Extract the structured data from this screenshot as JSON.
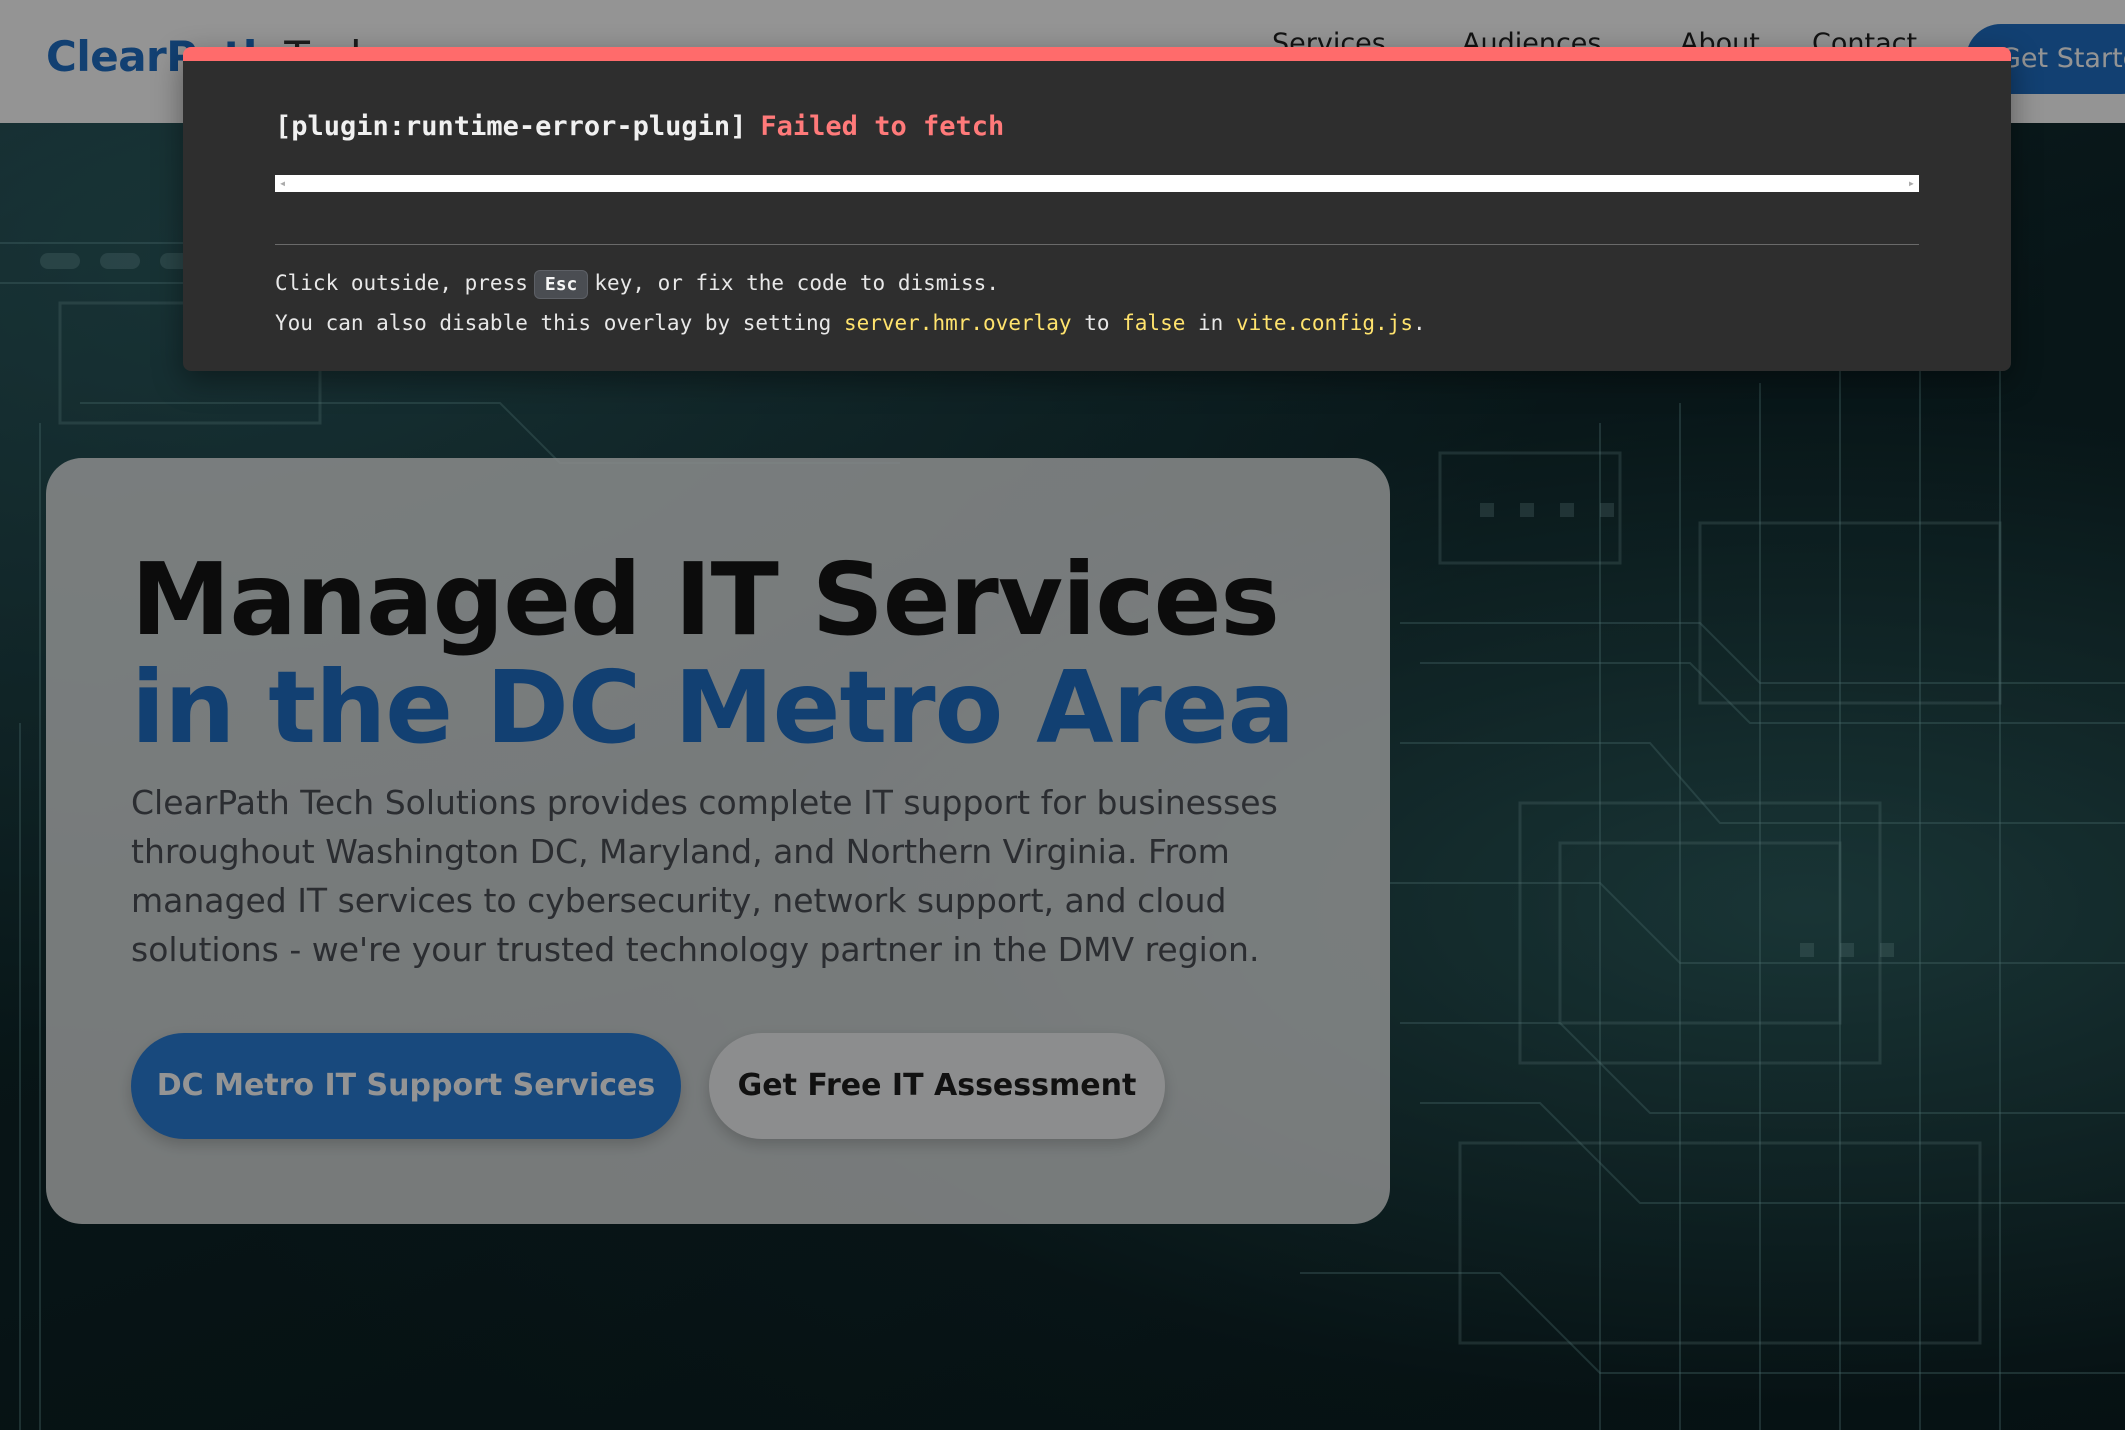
{
  "header": {
    "logo_main": "ClearPath",
    "logo_sub": "Tech",
    "nav": [
      {
        "label": "Services",
        "has_dropdown": true
      },
      {
        "label": "Audiences",
        "has_dropdown": true
      },
      {
        "label": "About",
        "has_dropdown": false
      },
      {
        "label": "Contact",
        "has_dropdown": false
      }
    ],
    "cta_label": "Get Started"
  },
  "hero": {
    "title_main": "Managed IT Services",
    "title_accent": "in the DC Metro Area",
    "description": "ClearPath Tech Solutions provides complete IT support for businesses throughout Washington DC, Maryland, and Northern Virginia. From managed IT services to cybersecurity, network support, and cloud solutions - we're your trusted technology partner in the DMV region.",
    "primary_button": "DC Metro IT Support Services",
    "secondary_button": "Get Free IT Assessment"
  },
  "error_overlay": {
    "plugin": "[plugin:runtime-error-plugin]",
    "message": "Failed to fetch",
    "hint_prefix": "Click outside, press",
    "hint_key": "Esc",
    "hint_suffix": "key, or fix the code to dismiss.",
    "disable_prefix": "You can also disable this overlay by setting",
    "disable_setting": "server.hmr.overlay",
    "disable_to": "to",
    "disable_value": "false",
    "disable_in": "in",
    "disable_file": "vite.config.js",
    "disable_end": "."
  },
  "colors": {
    "brand_blue": "#1f6fc5",
    "overlay_accent": "#ff6b6b",
    "code_highlight": "#ffe36d"
  }
}
